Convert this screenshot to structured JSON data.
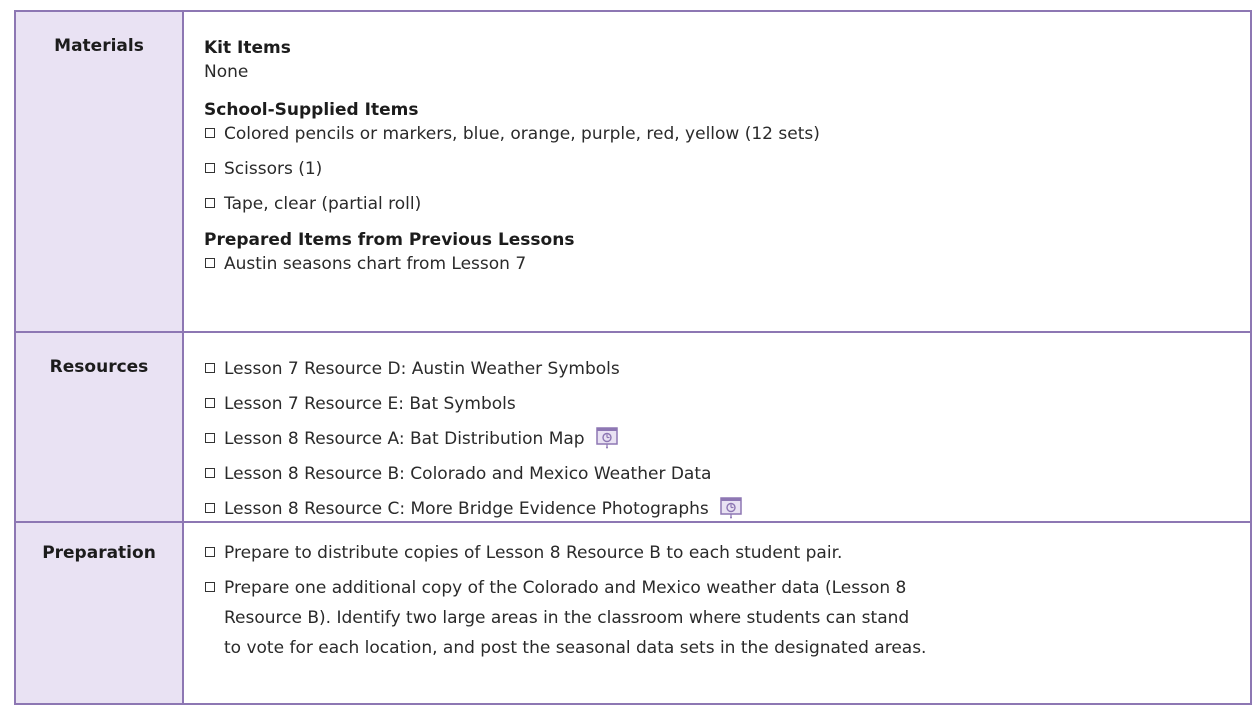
{
  "materials": {
    "label": "Materials",
    "kit_items": {
      "title": "Kit Items",
      "value": "None"
    },
    "school_supplied": {
      "title": "School-Supplied Items",
      "items": [
        "Colored pencils or markers, blue, orange, purple, red, yellow (12 sets)",
        "Scissors (1)",
        "Tape, clear (partial roll)"
      ]
    },
    "prepared": {
      "title": "Prepared Items from Previous Lessons",
      "items": [
        "Austin seasons chart from Lesson 7"
      ]
    }
  },
  "resources": {
    "label": "Resources",
    "items": [
      {
        "text": "Lesson 7 Resource D: Austin Weather Symbols",
        "icon": ""
      },
      {
        "text": "Lesson 7 Resource E: Bat Symbols",
        "icon": ""
      },
      {
        "text": "Lesson 8 Resource A: Bat Distribution Map",
        "icon": "projector-screen-icon"
      },
      {
        "text": "Lesson 8 Resource B: Colorado and Mexico Weather Data",
        "icon": ""
      },
      {
        "text": "Lesson 8 Resource C: More Bridge Evidence Photographs",
        "icon": "projector-screen-icon"
      }
    ]
  },
  "preparation": {
    "label": "Preparation",
    "items": [
      "Prepare to distribute copies of Lesson 8 Resource B to each student pair.",
      "Prepare one additional copy of the Colorado and Mexico weather data (Lesson 8 Resource B). Identify two large areas in the classroom where students can stand to vote for each location, and post the seasonal data sets in the designated areas."
    ]
  },
  "colors": {
    "border": "#8d77b3",
    "header_fill": "#e9e2f3",
    "icon_accent": "#8d77b3"
  }
}
